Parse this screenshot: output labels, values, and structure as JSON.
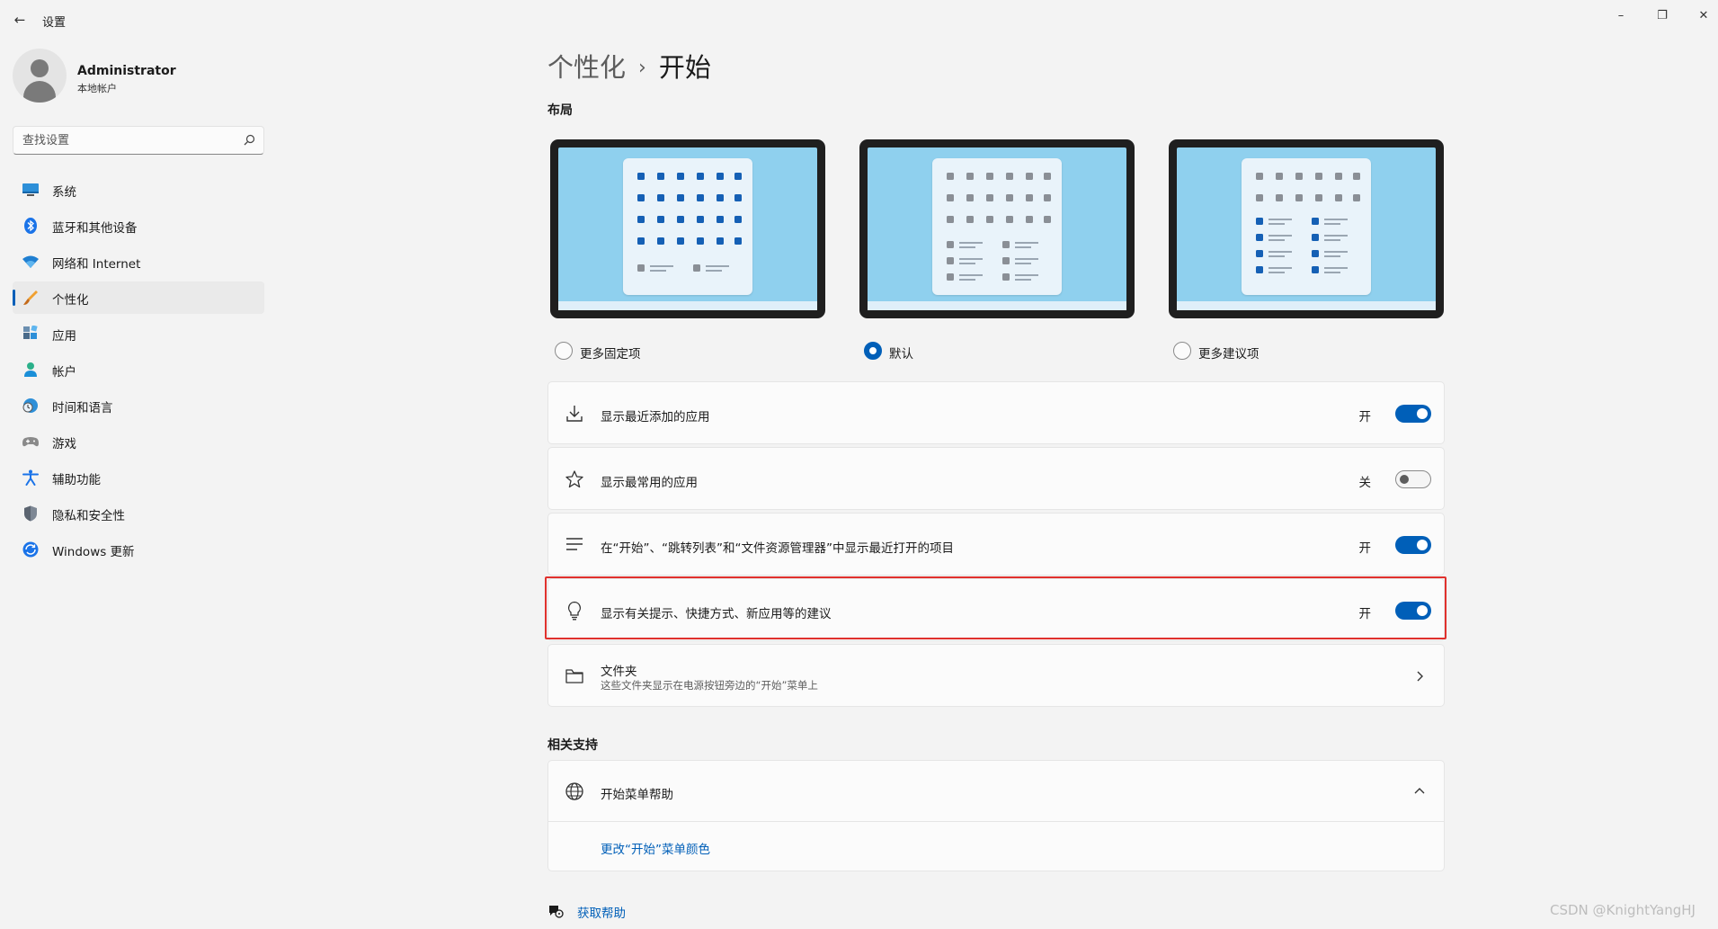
{
  "app": {
    "title": "设置"
  },
  "window_controls": {
    "minimize": "–",
    "maximize": "❐",
    "close": "✕"
  },
  "user": {
    "name": "Administrator",
    "account_type": "本地帐户"
  },
  "search": {
    "placeholder": "查找设置"
  },
  "nav": {
    "items": [
      {
        "label": "系统",
        "icon": "system-monitor-icon"
      },
      {
        "label": "蓝牙和其他设备",
        "icon": "bluetooth-icon"
      },
      {
        "label": "网络和 Internet",
        "icon": "wifi-icon"
      },
      {
        "label": "个性化",
        "icon": "paintbrush-icon",
        "active": true
      },
      {
        "label": "应用",
        "icon": "apps-icon"
      },
      {
        "label": "帐户",
        "icon": "person-icon"
      },
      {
        "label": "时间和语言",
        "icon": "globe-clock-icon"
      },
      {
        "label": "游戏",
        "icon": "gamepad-icon"
      },
      {
        "label": "辅助功能",
        "icon": "accessibility-icon"
      },
      {
        "label": "隐私和安全性",
        "icon": "shield-icon"
      },
      {
        "label": "Windows 更新",
        "icon": "update-icon"
      }
    ]
  },
  "breadcrumb": {
    "parent": "个性化",
    "separator": "›",
    "current": "开始"
  },
  "layout_section": {
    "heading": "布局",
    "options": [
      {
        "label": "更多固定项",
        "selected": false,
        "variant": "more-pins"
      },
      {
        "label": "默认",
        "selected": true,
        "variant": "default"
      },
      {
        "label": "更多建议项",
        "selected": false,
        "variant": "more-recommendations"
      }
    ]
  },
  "settings": [
    {
      "label": "显示最近添加的应用",
      "icon": "download-icon",
      "state": "开",
      "on": true
    },
    {
      "label": "显示最常用的应用",
      "icon": "star-icon",
      "state": "关",
      "on": false
    },
    {
      "label": "在“开始”、“跳转列表”和“文件资源管理器”中显示最近打开的项目",
      "icon": "list-lines-icon",
      "state": "开",
      "on": true
    },
    {
      "label": "显示有关提示、快捷方式、新应用等的建议",
      "icon": "lightbulb-icon",
      "state": "开",
      "on": true,
      "highlighted": true
    }
  ],
  "folders": {
    "title": "文件夹",
    "subtitle": "这些文件夹显示在电源按钮旁边的“开始”菜单上",
    "icon": "folder-icon"
  },
  "related": {
    "heading": "相关支持",
    "help_title": "开始菜单帮助",
    "help_icon": "globe-icon",
    "link": "更改“开始”菜单颜色"
  },
  "get_help": {
    "label": "获取帮助",
    "icon": "help-chat-icon"
  },
  "watermark": "CSDN @KnightYangHJ",
  "colors": {
    "accent": "#005fb8",
    "highlight_border": "#e0312d",
    "screen": "#8fd0ee",
    "background": "#f3f3f3"
  }
}
